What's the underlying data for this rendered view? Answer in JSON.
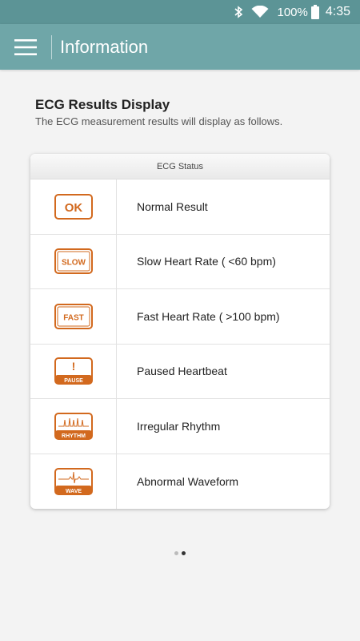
{
  "status_bar": {
    "battery": "100%",
    "time": "4:35",
    "icons": [
      "bluetooth-icon",
      "wifi-icon",
      "battery-icon"
    ]
  },
  "app_bar": {
    "title": "Information",
    "menu_icon": "hamburger-menu-icon"
  },
  "page": {
    "heading": "ECG Results Display",
    "subheading": "The ECG measurement results will display as follows."
  },
  "table": {
    "header": "ECG Status",
    "rows": [
      {
        "icon_text": "OK",
        "label": "Normal Result"
      },
      {
        "icon_text": "SLOW",
        "label": "Slow Heart Rate ( <60 bpm)"
      },
      {
        "icon_text": "FAST",
        "label": "Fast Heart Rate ( >100 bpm)"
      },
      {
        "icon_text": "PAUSE",
        "label": "Paused Heartbeat"
      },
      {
        "icon_text": "RHYTHM",
        "label": "Irregular Rhythm"
      },
      {
        "icon_text": "WAVE",
        "label": "Abnormal Waveform"
      }
    ]
  },
  "pager": {
    "count": 2,
    "active": 1
  },
  "colors": {
    "status_bar": "#5c9496",
    "app_bar": "#6fa6a8",
    "icon_orange": "#d2691e"
  }
}
